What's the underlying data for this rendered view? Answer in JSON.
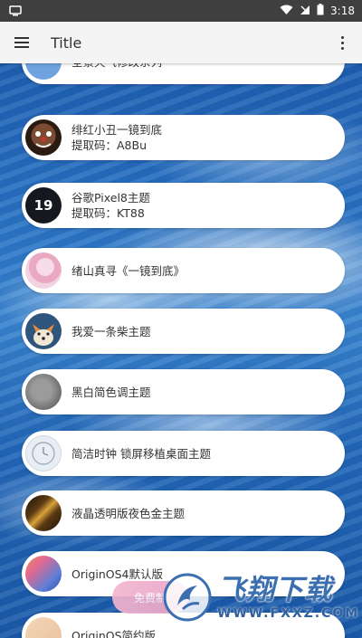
{
  "status_bar": {
    "time": "3:18",
    "icons": [
      "notification-icon",
      "wifi-icon",
      "signal-icon",
      "battery-icon"
    ]
  },
  "app_bar": {
    "title": "Title",
    "menu_icon": "hamburger-menu-icon",
    "more_icon": "more-vert-icon"
  },
  "items": [
    {
      "line1": "全景天气修改系列",
      "line2": ""
    },
    {
      "line1": "绯红小丑一镜到底",
      "line2": "提取码：A8Bu"
    },
    {
      "line1": "谷歌Pixel8主题",
      "line2": "提取码：KT88"
    },
    {
      "line1": "绪山真寻《一镜到底》",
      "line2": ""
    },
    {
      "line1": "我爱一条柴主题",
      "line2": ""
    },
    {
      "line1": "黑白简色调主题",
      "line2": ""
    },
    {
      "line1": "简洁时钟 锁屏移植桌面主题",
      "line2": ""
    },
    {
      "line1": "液晶透明版夜色金主题",
      "line2": ""
    },
    {
      "line1": "OriginOS4默认版",
      "line2": ""
    },
    {
      "line1": "OriginOS简约版",
      "line2": ""
    }
  ],
  "thumb_text": {
    "pixel": "19"
  },
  "free_button": {
    "label": "免费制"
  },
  "watermark": {
    "name": "飞翔下载",
    "url": "WWW.FXXZ.COM"
  }
}
